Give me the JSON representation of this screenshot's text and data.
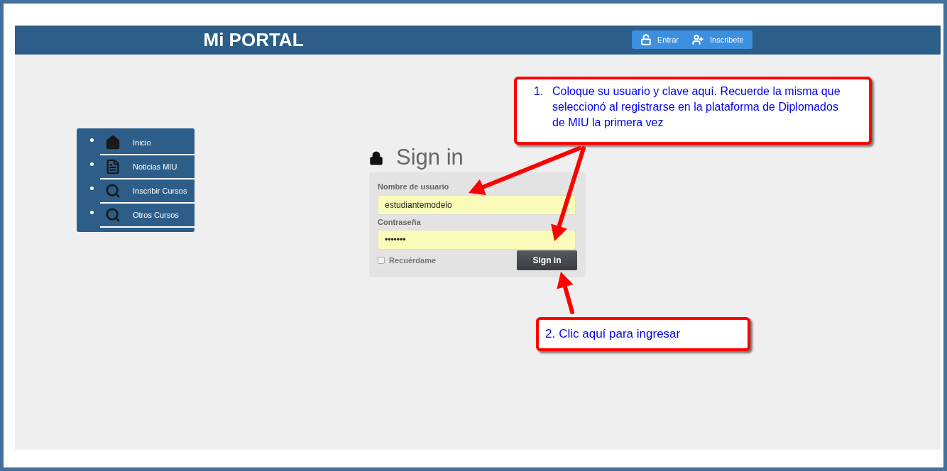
{
  "header": {
    "title": "Mi PORTAL",
    "buttons": [
      {
        "label": "Entrar",
        "kind": "login"
      },
      {
        "label": "Inscribete",
        "kind": "register"
      }
    ]
  },
  "sidebar": {
    "items": [
      {
        "label": "Inicio",
        "kind": "home"
      },
      {
        "label": "Noticias MIU",
        "kind": "news"
      },
      {
        "label": "Inscribir Cursos",
        "kind": "search"
      },
      {
        "label": "Otros Cursos",
        "kind": "search"
      }
    ]
  },
  "signin": {
    "title": "Sign in",
    "username_label": "Nombre de usuario",
    "username_value": "estudiantemodelo",
    "password_label": "Contraseña",
    "password_value": "•••••••",
    "remember": {
      "label": "Recuérdame",
      "checked": false
    },
    "button": "Sign in"
  },
  "callouts": [
    {
      "number": "1.",
      "text": "Coloque su usuario y clave aquí. Recuerde la misma que seleccionó al registrarse en la plataforma de Diplomados de MIU la primera vez"
    },
    {
      "number": "2.",
      "text": "Clic aquí para ingresar"
    }
  ]
}
